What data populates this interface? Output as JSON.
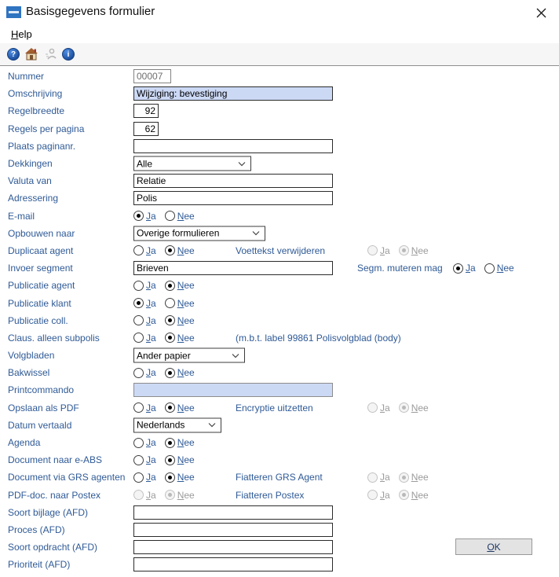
{
  "window": {
    "title": "Basisgegevens formulier"
  },
  "menu": {
    "help_label": "Help"
  },
  "toolbar": {
    "icons": [
      "help-icon",
      "home-icon",
      "users-icon",
      "info-icon"
    ]
  },
  "labels": {
    "ja": "Ja",
    "nee": "Nee"
  },
  "buttons": {
    "ok": "OK"
  },
  "colors": {
    "label_blue": "#2f5a96",
    "highlight_field_bg": "#ccd9f5",
    "logo_blue": "#2f74c0",
    "disabled_gray": "#9b9b9b",
    "toolbar_bg": "#f6f6f6"
  },
  "form": {
    "rows": [
      {
        "label": "Nummer",
        "value": "00007",
        "enabled": false
      },
      {
        "label": "Omschrijving",
        "value": "Wijziging: bevestiging"
      },
      {
        "label": "Regelbreedte",
        "value": "92"
      },
      {
        "label": "Regels per pagina",
        "value": "62"
      },
      {
        "label": "Plaats paginanr.",
        "value": ""
      },
      {
        "label": "Dekkingen",
        "value": "Alle"
      },
      {
        "label": "Valuta van",
        "value": "Relatie"
      },
      {
        "label": "Adressering",
        "value": "Polis"
      },
      {
        "label": "E-mail",
        "selected": "Ja"
      },
      {
        "label": "Opbouwen naar",
        "value": "Overige formulieren"
      },
      {
        "label": "Duplicaat agent",
        "selected": "Nee",
        "extra": {
          "label": "Voettekst verwijderen",
          "selected": "Nee",
          "enabled": false
        }
      },
      {
        "label": "Invoer segment",
        "value": "Brieven",
        "extra": {
          "label": "Segm. muteren mag",
          "selected": "Ja",
          "enabled": true
        }
      },
      {
        "label": "Publicatie agent",
        "selected": "Nee"
      },
      {
        "label": "Publicatie klant",
        "selected": "Ja"
      },
      {
        "label": "Publicatie coll.",
        "selected": "Nee"
      },
      {
        "label": "Claus. alleen subpolis",
        "selected": "Nee",
        "note": "(m.b.t. label 99861 Polisvolgblad (body)"
      },
      {
        "label": "Volgbladen",
        "value": "Ander papier"
      },
      {
        "label": "Bakwissel",
        "selected": "Nee"
      },
      {
        "label": "Printcommando",
        "value": ""
      },
      {
        "label": "Opslaan als PDF",
        "selected": "Nee",
        "extra": {
          "label": "Encryptie uitzetten",
          "selected": "Nee",
          "enabled": false
        }
      },
      {
        "label": "Datum vertaald",
        "value": "Nederlands"
      },
      {
        "label": "Agenda",
        "selected": "Nee"
      },
      {
        "label": "Document naar e-ABS",
        "selected": "Nee"
      },
      {
        "label": "Document via GRS agenten",
        "selected": "Nee",
        "extra": {
          "label": "Fiatteren GRS Agent",
          "selected": "Nee",
          "enabled": false
        }
      },
      {
        "label": "PDF-doc. naar Postex",
        "selected": "Nee",
        "enabled": false,
        "extra": {
          "label": "Fiatteren Postex",
          "selected": "Nee",
          "enabled": false
        }
      },
      {
        "label": "Soort bijlage (AFD)",
        "value": ""
      },
      {
        "label": "Proces (AFD)",
        "value": ""
      },
      {
        "label": "Soort opdracht (AFD)",
        "value": ""
      },
      {
        "label": "Prioriteit (AFD)",
        "value": ""
      }
    ]
  }
}
